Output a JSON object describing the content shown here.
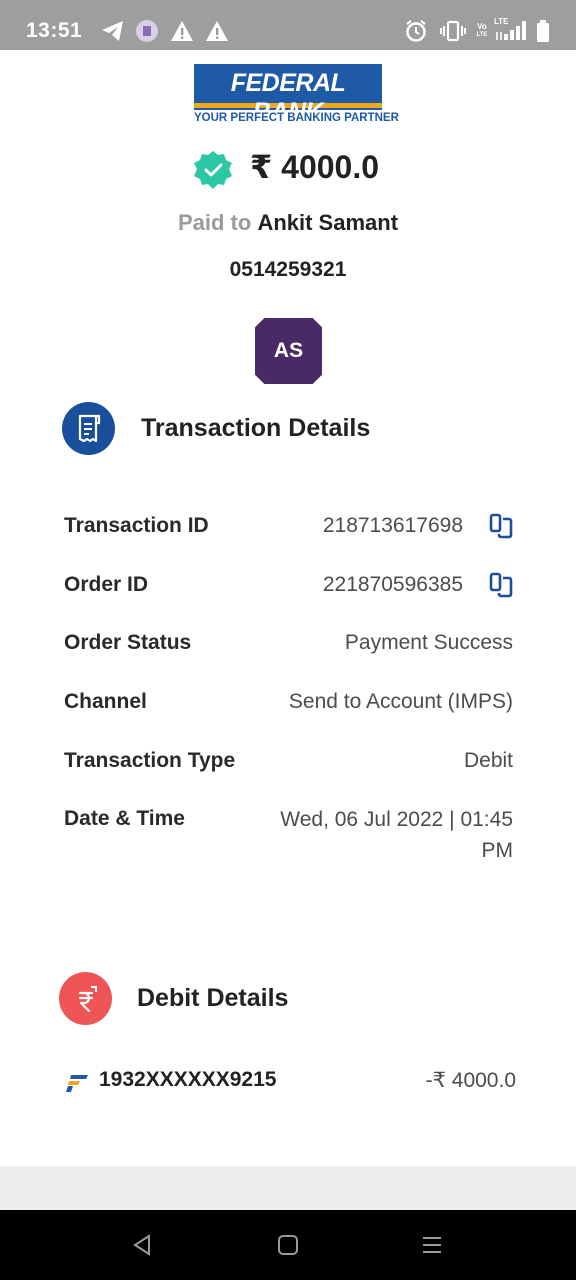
{
  "status_bar": {
    "time": "13:51",
    "left_icons": [
      "telegram-icon",
      "app-notification-icon",
      "warning-icon",
      "warning-icon"
    ],
    "right_icons": [
      "alarm-icon",
      "vibrate-icon",
      "volte-icon",
      "signal-icon",
      "battery-icon"
    ],
    "volte_top": "Vo",
    "volte_bottom": "LTE",
    "lte_label": "LTE"
  },
  "logo": {
    "name": "FEDERAL BANK",
    "tagline": "YOUR PERFECT BANKING PARTNER",
    "brand_blue": "#1f5aa6",
    "brand_orange": "#f3a81b"
  },
  "payment": {
    "status_icon": "check-badge-icon",
    "status_color": "#2cc7a5",
    "amount": "₹ 4000.0",
    "paid_to_label": "Paid to",
    "payee_name": "Ankit Samant",
    "account_number": "0514259321",
    "avatar_initials": "AS",
    "avatar_color": "#4a2a66"
  },
  "transaction_details": {
    "title": "Transaction Details",
    "icon": "receipt-icon",
    "icon_color": "#1a4f9c",
    "rows": [
      {
        "label": "Transaction ID",
        "value": "218713617698",
        "copy_icon": "copy-icon"
      },
      {
        "label": "Order ID",
        "value": "221870596385",
        "copy_icon": "copy-icon"
      },
      {
        "label": "Order Status",
        "value": "Payment Success"
      },
      {
        "label": "Channel",
        "value": "Send to Account (IMPS)"
      },
      {
        "label": "Transaction Type",
        "value": "Debit"
      },
      {
        "label": "Date & Time",
        "value": "Wed, 06 Jul 2022 | 01:45 PM"
      }
    ]
  },
  "debit_details": {
    "title": "Debit Details",
    "icon": "rupee-transfer-icon",
    "icon_color": "#f05555",
    "bank_icon": "federal-bank-mark-icon",
    "account": "1932XXXXXX9215",
    "amount": "-₹ 4000.0"
  },
  "nav_bar": {
    "buttons": [
      "back-icon",
      "home-icon",
      "recents-icon"
    ]
  }
}
